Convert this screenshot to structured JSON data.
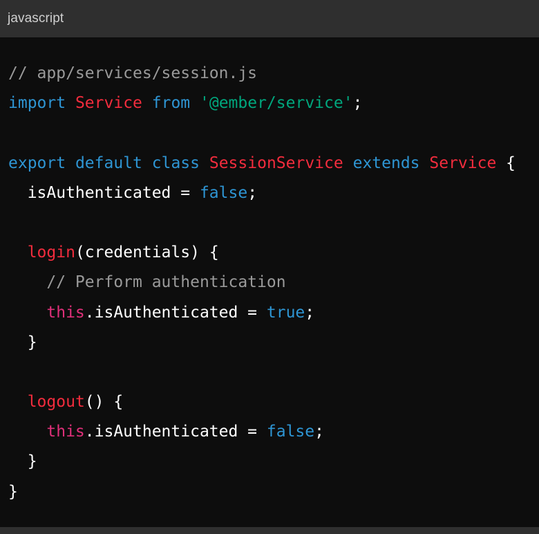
{
  "header": {
    "language": "javascript"
  },
  "colors": {
    "header_bg": "#2f2f2f",
    "code_bg": "#0d0d0d",
    "comment": "#9a9a9a",
    "keyword": "#2e95d3",
    "class_name": "#f22c3d",
    "string": "#00a67d",
    "this": "#df3079",
    "plain": "#ffffff"
  },
  "code": {
    "lines": [
      [
        {
          "t": "comment",
          "v": "// app/services/session.js"
        }
      ],
      [
        {
          "t": "keyword",
          "v": "import"
        },
        {
          "t": "plain",
          "v": " "
        },
        {
          "t": "class",
          "v": "Service"
        },
        {
          "t": "plain",
          "v": " "
        },
        {
          "t": "keyword",
          "v": "from"
        },
        {
          "t": "plain",
          "v": " "
        },
        {
          "t": "string",
          "v": "'@ember/service'"
        },
        {
          "t": "plain",
          "v": ";"
        }
      ],
      [],
      [
        {
          "t": "keyword",
          "v": "export"
        },
        {
          "t": "plain",
          "v": " "
        },
        {
          "t": "keyword",
          "v": "default"
        },
        {
          "t": "plain",
          "v": " "
        },
        {
          "t": "keyword",
          "v": "class"
        },
        {
          "t": "plain",
          "v": " "
        },
        {
          "t": "class",
          "v": "SessionService"
        },
        {
          "t": "plain",
          "v": " "
        },
        {
          "t": "keyword",
          "v": "extends"
        },
        {
          "t": "plain",
          "v": " "
        },
        {
          "t": "class",
          "v": "Service"
        },
        {
          "t": "plain",
          "v": " {"
        }
      ],
      [
        {
          "t": "plain",
          "v": "  isAuthenticated = "
        },
        {
          "t": "keyword",
          "v": "false"
        },
        {
          "t": "plain",
          "v": ";"
        }
      ],
      [],
      [
        {
          "t": "plain",
          "v": "  "
        },
        {
          "t": "class",
          "v": "login"
        },
        {
          "t": "plain",
          "v": "(credentials) {"
        }
      ],
      [
        {
          "t": "plain",
          "v": "    "
        },
        {
          "t": "comment",
          "v": "// Perform authentication"
        }
      ],
      [
        {
          "t": "plain",
          "v": "    "
        },
        {
          "t": "this",
          "v": "this"
        },
        {
          "t": "plain",
          "v": ".isAuthenticated = "
        },
        {
          "t": "keyword",
          "v": "true"
        },
        {
          "t": "plain",
          "v": ";"
        }
      ],
      [
        {
          "t": "plain",
          "v": "  }"
        }
      ],
      [],
      [
        {
          "t": "plain",
          "v": "  "
        },
        {
          "t": "class",
          "v": "logout"
        },
        {
          "t": "plain",
          "v": "() {"
        }
      ],
      [
        {
          "t": "plain",
          "v": "    "
        },
        {
          "t": "this",
          "v": "this"
        },
        {
          "t": "plain",
          "v": ".isAuthenticated = "
        },
        {
          "t": "keyword",
          "v": "false"
        },
        {
          "t": "plain",
          "v": ";"
        }
      ],
      [
        {
          "t": "plain",
          "v": "  }"
        }
      ],
      [
        {
          "t": "plain",
          "v": "}"
        }
      ]
    ]
  }
}
